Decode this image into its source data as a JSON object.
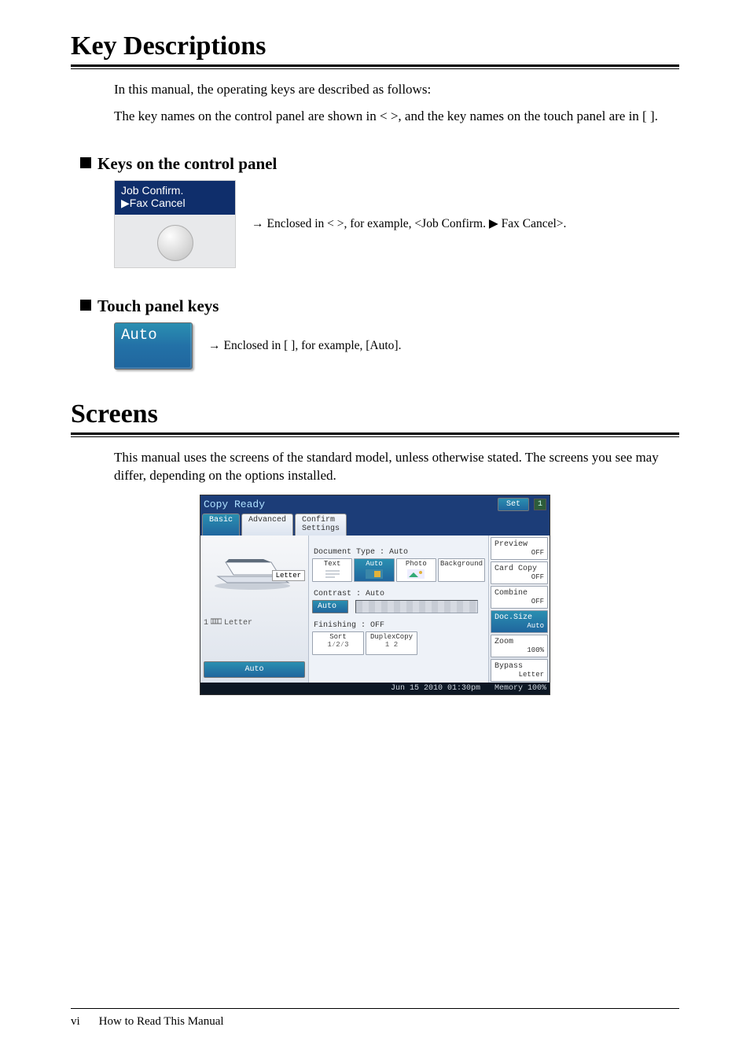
{
  "headings": {
    "key_descriptions": "Key Descriptions",
    "screens": "Screens",
    "keys_on_control_panel": "Keys on the control panel",
    "touch_panel_keys": "Touch panel keys"
  },
  "paragraphs": {
    "intro1": "In this manual, the operating keys are described as follows:",
    "intro2": "The key names on the control panel are shown in <  >, and the key names on the touch panel are in [  ].",
    "screens": "This manual uses the screens of the standard model, unless otherwise stated. The screens you see may differ, depending on the options installed."
  },
  "examples": {
    "control_panel_label_line1": "Job Confirm.",
    "control_panel_label_line2": "▶Fax Cancel",
    "control_panel_desc": "Enclosed in < >, for example, <Job Confirm. ▶ Fax Cancel>.",
    "touch_key_label": "Auto",
    "touch_key_desc": "Enclosed in [ ], for example, [Auto]."
  },
  "screen": {
    "title": "Copy Ready",
    "set": "Set",
    "set_count": "1",
    "tabs": {
      "basic": "Basic",
      "advanced": "Advanced",
      "confirm": "Confirm\nSettings"
    },
    "left": {
      "paper_label": "Letter",
      "tray_index": "1",
      "tray_label": "Letter",
      "auto": "Auto"
    },
    "mid": {
      "doc_type_label": "Document Type : Auto",
      "opts": {
        "text": "Text",
        "auto": "Auto",
        "photo": "Photo",
        "background": "Background"
      },
      "contrast_label": "Contrast     : Auto",
      "contrast_btn": "Auto",
      "finishing_label": "Finishing    : OFF",
      "sort": "Sort",
      "sort_val": "1⁄2⁄3",
      "duplex": "DuplexCopy",
      "duplex_val": "1  2"
    },
    "right": [
      {
        "name": "Preview",
        "val": "OFF",
        "sel": false
      },
      {
        "name": "Card Copy",
        "val": "OFF",
        "sel": false
      },
      {
        "name": "Combine",
        "val": "OFF",
        "sel": false
      },
      {
        "name": "Doc.Size",
        "val": "Auto",
        "sel": true
      },
      {
        "name": "Zoom",
        "val": "100%",
        "sel": false
      },
      {
        "name": "Bypass",
        "val": "Letter",
        "sel": false
      }
    ],
    "status": {
      "datetime": "Jun 15 2010 01:30pm",
      "memory": "Memory  100%"
    }
  },
  "footer": {
    "page": "vi",
    "section": "How to Read This Manual"
  }
}
